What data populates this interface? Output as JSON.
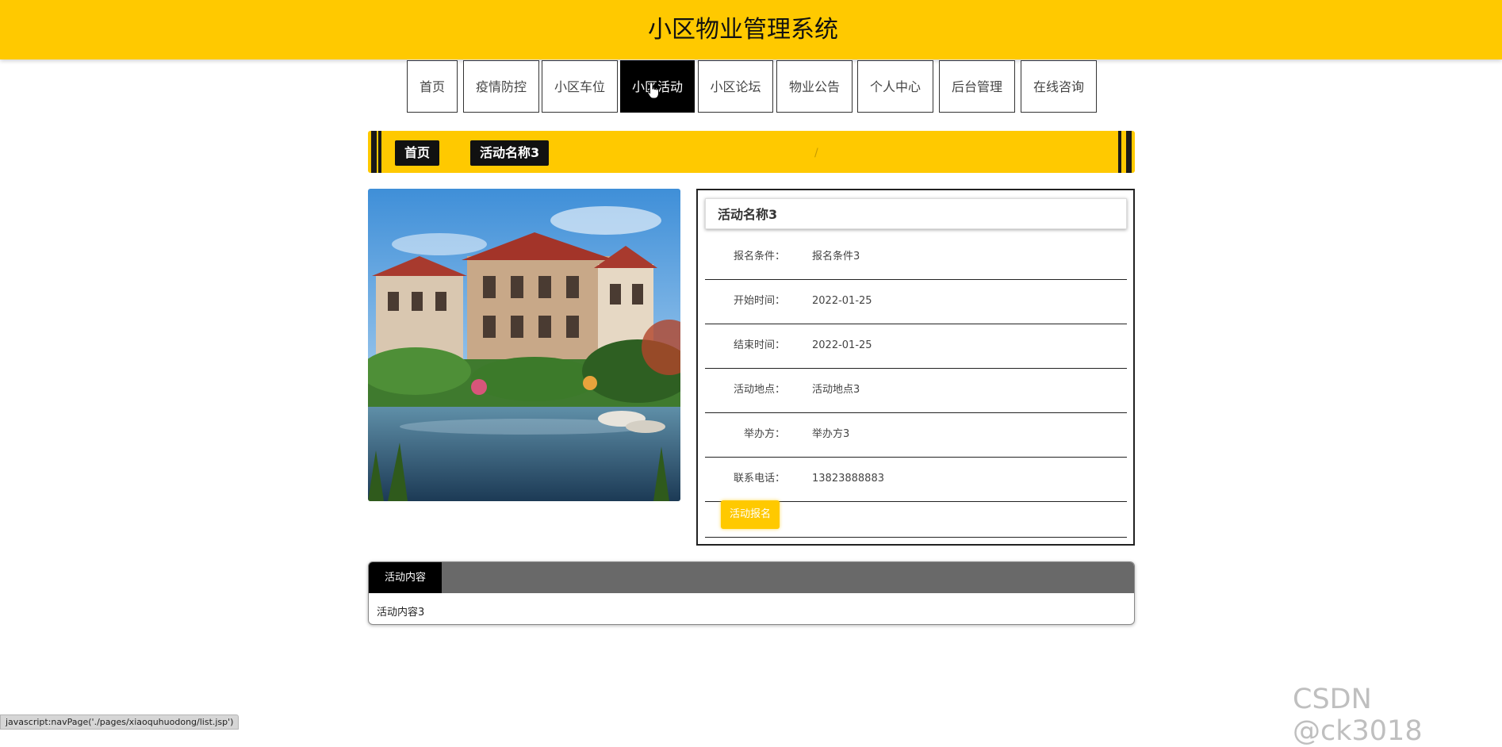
{
  "header": {
    "title": "小区物业管理系统"
  },
  "nav": {
    "items": [
      {
        "label": "首页"
      },
      {
        "label": "疫情防控"
      },
      {
        "label": "小区车位"
      },
      {
        "label": "小区活动"
      },
      {
        "label": "小区论坛"
      },
      {
        "label": "物业公告"
      },
      {
        "label": "个人中心"
      },
      {
        "label": "后台管理"
      },
      {
        "label": "在线咨询"
      }
    ],
    "active": "小区活动"
  },
  "breadcrumb": {
    "home": "首页",
    "separator": "/",
    "current": "活动名称3"
  },
  "detail": {
    "title": "活动名称3",
    "rows": [
      {
        "label": "报名条件：",
        "value": "报名条件3"
      },
      {
        "label": "开始时间：",
        "value": "2022-01-25"
      },
      {
        "label": "结束时间：",
        "value": "2022-01-25"
      },
      {
        "label": "活动地点：",
        "value": "活动地点3"
      },
      {
        "label": "举办方：",
        "value": "举办方3"
      },
      {
        "label": "联系电话：",
        "value": "13823888883"
      }
    ],
    "signup_label": "活动报名"
  },
  "content": {
    "tab_label": "活动内容",
    "text": "活动内容3"
  },
  "status_bar": {
    "text": "javascript:navPage('./pages/xiaoquhuodong/list.jsp')"
  },
  "watermark": {
    "text": "CSDN @ck3018"
  },
  "colors": {
    "accent": "#ffc900",
    "dark": "#000000",
    "tab_bar": "#696969"
  }
}
